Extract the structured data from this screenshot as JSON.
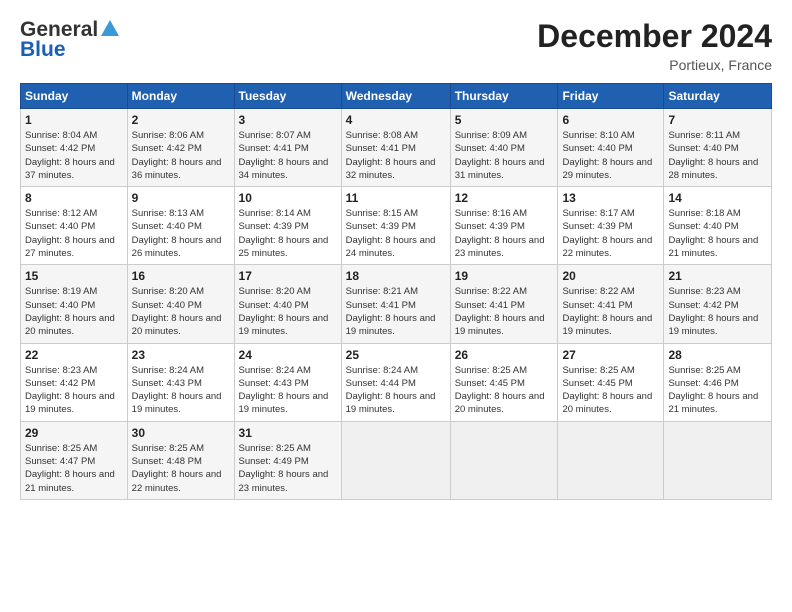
{
  "logo": {
    "line1": "General",
    "line2": "Blue"
  },
  "header": {
    "title": "December 2024",
    "subtitle": "Portieux, France"
  },
  "weekdays": [
    "Sunday",
    "Monday",
    "Tuesday",
    "Wednesday",
    "Thursday",
    "Friday",
    "Saturday"
  ],
  "weeks": [
    [
      {
        "day": "1",
        "sunrise": "Sunrise: 8:04 AM",
        "sunset": "Sunset: 4:42 PM",
        "daylight": "Daylight: 8 hours and 37 minutes."
      },
      {
        "day": "2",
        "sunrise": "Sunrise: 8:06 AM",
        "sunset": "Sunset: 4:42 PM",
        "daylight": "Daylight: 8 hours and 36 minutes."
      },
      {
        "day": "3",
        "sunrise": "Sunrise: 8:07 AM",
        "sunset": "Sunset: 4:41 PM",
        "daylight": "Daylight: 8 hours and 34 minutes."
      },
      {
        "day": "4",
        "sunrise": "Sunrise: 8:08 AM",
        "sunset": "Sunset: 4:41 PM",
        "daylight": "Daylight: 8 hours and 32 minutes."
      },
      {
        "day": "5",
        "sunrise": "Sunrise: 8:09 AM",
        "sunset": "Sunset: 4:40 PM",
        "daylight": "Daylight: 8 hours and 31 minutes."
      },
      {
        "day": "6",
        "sunrise": "Sunrise: 8:10 AM",
        "sunset": "Sunset: 4:40 PM",
        "daylight": "Daylight: 8 hours and 29 minutes."
      },
      {
        "day": "7",
        "sunrise": "Sunrise: 8:11 AM",
        "sunset": "Sunset: 4:40 PM",
        "daylight": "Daylight: 8 hours and 28 minutes."
      }
    ],
    [
      {
        "day": "8",
        "sunrise": "Sunrise: 8:12 AM",
        "sunset": "Sunset: 4:40 PM",
        "daylight": "Daylight: 8 hours and 27 minutes."
      },
      {
        "day": "9",
        "sunrise": "Sunrise: 8:13 AM",
        "sunset": "Sunset: 4:40 PM",
        "daylight": "Daylight: 8 hours and 26 minutes."
      },
      {
        "day": "10",
        "sunrise": "Sunrise: 8:14 AM",
        "sunset": "Sunset: 4:39 PM",
        "daylight": "Daylight: 8 hours and 25 minutes."
      },
      {
        "day": "11",
        "sunrise": "Sunrise: 8:15 AM",
        "sunset": "Sunset: 4:39 PM",
        "daylight": "Daylight: 8 hours and 24 minutes."
      },
      {
        "day": "12",
        "sunrise": "Sunrise: 8:16 AM",
        "sunset": "Sunset: 4:39 PM",
        "daylight": "Daylight: 8 hours and 23 minutes."
      },
      {
        "day": "13",
        "sunrise": "Sunrise: 8:17 AM",
        "sunset": "Sunset: 4:39 PM",
        "daylight": "Daylight: 8 hours and 22 minutes."
      },
      {
        "day": "14",
        "sunrise": "Sunrise: 8:18 AM",
        "sunset": "Sunset: 4:40 PM",
        "daylight": "Daylight: 8 hours and 21 minutes."
      }
    ],
    [
      {
        "day": "15",
        "sunrise": "Sunrise: 8:19 AM",
        "sunset": "Sunset: 4:40 PM",
        "daylight": "Daylight: 8 hours and 20 minutes."
      },
      {
        "day": "16",
        "sunrise": "Sunrise: 8:20 AM",
        "sunset": "Sunset: 4:40 PM",
        "daylight": "Daylight: 8 hours and 20 minutes."
      },
      {
        "day": "17",
        "sunrise": "Sunrise: 8:20 AM",
        "sunset": "Sunset: 4:40 PM",
        "daylight": "Daylight: 8 hours and 19 minutes."
      },
      {
        "day": "18",
        "sunrise": "Sunrise: 8:21 AM",
        "sunset": "Sunset: 4:41 PM",
        "daylight": "Daylight: 8 hours and 19 minutes."
      },
      {
        "day": "19",
        "sunrise": "Sunrise: 8:22 AM",
        "sunset": "Sunset: 4:41 PM",
        "daylight": "Daylight: 8 hours and 19 minutes."
      },
      {
        "day": "20",
        "sunrise": "Sunrise: 8:22 AM",
        "sunset": "Sunset: 4:41 PM",
        "daylight": "Daylight: 8 hours and 19 minutes."
      },
      {
        "day": "21",
        "sunrise": "Sunrise: 8:23 AM",
        "sunset": "Sunset: 4:42 PM",
        "daylight": "Daylight: 8 hours and 19 minutes."
      }
    ],
    [
      {
        "day": "22",
        "sunrise": "Sunrise: 8:23 AM",
        "sunset": "Sunset: 4:42 PM",
        "daylight": "Daylight: 8 hours and 19 minutes."
      },
      {
        "day": "23",
        "sunrise": "Sunrise: 8:24 AM",
        "sunset": "Sunset: 4:43 PM",
        "daylight": "Daylight: 8 hours and 19 minutes."
      },
      {
        "day": "24",
        "sunrise": "Sunrise: 8:24 AM",
        "sunset": "Sunset: 4:43 PM",
        "daylight": "Daylight: 8 hours and 19 minutes."
      },
      {
        "day": "25",
        "sunrise": "Sunrise: 8:24 AM",
        "sunset": "Sunset: 4:44 PM",
        "daylight": "Daylight: 8 hours and 19 minutes."
      },
      {
        "day": "26",
        "sunrise": "Sunrise: 8:25 AM",
        "sunset": "Sunset: 4:45 PM",
        "daylight": "Daylight: 8 hours and 20 minutes."
      },
      {
        "day": "27",
        "sunrise": "Sunrise: 8:25 AM",
        "sunset": "Sunset: 4:45 PM",
        "daylight": "Daylight: 8 hours and 20 minutes."
      },
      {
        "day": "28",
        "sunrise": "Sunrise: 8:25 AM",
        "sunset": "Sunset: 4:46 PM",
        "daylight": "Daylight: 8 hours and 21 minutes."
      }
    ],
    [
      {
        "day": "29",
        "sunrise": "Sunrise: 8:25 AM",
        "sunset": "Sunset: 4:47 PM",
        "daylight": "Daylight: 8 hours and 21 minutes."
      },
      {
        "day": "30",
        "sunrise": "Sunrise: 8:25 AM",
        "sunset": "Sunset: 4:48 PM",
        "daylight": "Daylight: 8 hours and 22 minutes."
      },
      {
        "day": "31",
        "sunrise": "Sunrise: 8:25 AM",
        "sunset": "Sunset: 4:49 PM",
        "daylight": "Daylight: 8 hours and 23 minutes."
      },
      null,
      null,
      null,
      null
    ]
  ]
}
